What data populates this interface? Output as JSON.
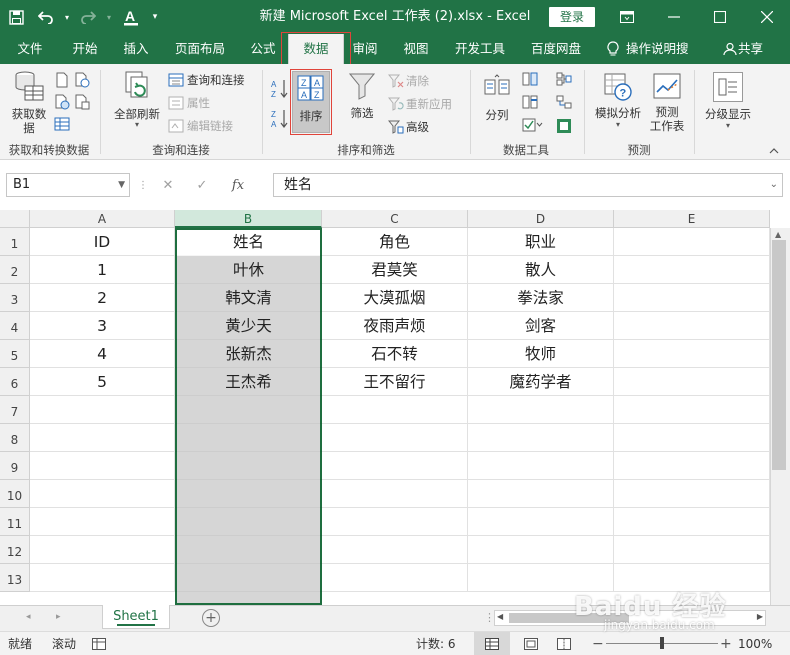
{
  "window": {
    "title": "新建 Microsoft Excel 工作表 (2).xlsx  -  Excel",
    "login": "登录"
  },
  "tabs": [
    {
      "label": "文件",
      "active": false
    },
    {
      "label": "开始",
      "active": false
    },
    {
      "label": "插入",
      "active": false
    },
    {
      "label": "页面布局",
      "active": false
    },
    {
      "label": "公式",
      "active": false
    },
    {
      "label": "数据",
      "active": true
    },
    {
      "label": "审阅",
      "active": false
    },
    {
      "label": "视图",
      "active": false
    },
    {
      "label": "开发工具",
      "active": false
    },
    {
      "label": "百度网盘",
      "active": false
    }
  ],
  "tell_me": "操作说明搜",
  "share": "共享",
  "ribbon": {
    "get_transform": {
      "label": "获取和转换数据",
      "get_data": "获取数\n据"
    },
    "queries": {
      "label": "查询和连接",
      "refresh_all": "全部刷新",
      "queries_connections": "查询和连接",
      "properties": "属性",
      "edit_links": "编辑链接"
    },
    "sort_filter": {
      "label": "排序和筛选",
      "sort": "排序",
      "filter": "筛选",
      "clear": "清除",
      "reapply": "重新应用",
      "advanced": "高级"
    },
    "data_tools": {
      "label": "数据工具",
      "text_to_columns": "分列"
    },
    "forecast": {
      "label": "预测",
      "what_if": "模拟分析",
      "forecast_sheet": "预测\n工作表"
    },
    "outline": {
      "label": "分级显示"
    }
  },
  "name_box": "B1",
  "formula": "姓名",
  "columns": [
    "A",
    "B",
    "C",
    "D",
    "E"
  ],
  "rows": [
    "1",
    "2",
    "3",
    "4",
    "5",
    "6",
    "7",
    "8",
    "9",
    "10",
    "11",
    "12",
    "13"
  ],
  "table": [
    [
      "ID",
      "姓名",
      "角色",
      "职业"
    ],
    [
      "1",
      "叶休",
      "君莫笑",
      "散人"
    ],
    [
      "2",
      "韩文清",
      "大漠孤烟",
      "拳法家"
    ],
    [
      "3",
      "黄少天",
      "夜雨声烦",
      "剑客"
    ],
    [
      "4",
      "张新杰",
      "石不转",
      "牧师"
    ],
    [
      "5",
      "王杰希",
      "王不留行",
      "魔药学者"
    ]
  ],
  "sheet_tab": "Sheet1",
  "status": {
    "ready": "就绪",
    "scroll": "滚动",
    "count": "计数: 6",
    "zoom": "100%"
  },
  "watermark": {
    "brand": "Baidu 经验",
    "url": "jingyan.baidu.com"
  }
}
